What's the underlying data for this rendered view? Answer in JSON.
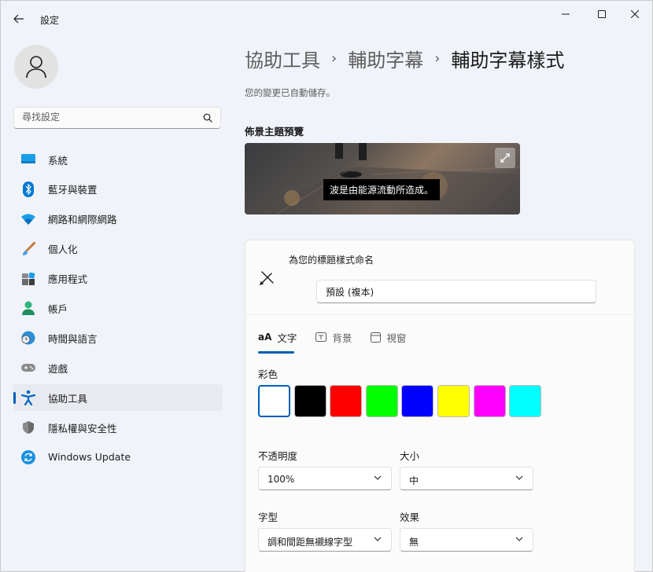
{
  "app": {
    "title": "設定"
  },
  "search": {
    "placeholder": "尋找設定"
  },
  "sidebar": {
    "items": [
      {
        "label": "系統",
        "icon": "monitor-icon"
      },
      {
        "label": "藍牙與裝置",
        "icon": "bluetooth-icon"
      },
      {
        "label": "網路和網際網路",
        "icon": "wifi-icon"
      },
      {
        "label": "個人化",
        "icon": "brush-icon"
      },
      {
        "label": "應用程式",
        "icon": "apps-icon"
      },
      {
        "label": "帳戶",
        "icon": "person-icon"
      },
      {
        "label": "時間與語言",
        "icon": "globe-clock-icon"
      },
      {
        "label": "遊戲",
        "icon": "gamepad-icon"
      },
      {
        "label": "協助工具",
        "icon": "accessibility-icon",
        "active": true
      },
      {
        "label": "隱私權與安全性",
        "icon": "shield-icon"
      },
      {
        "label": "Windows Update",
        "icon": "update-icon"
      }
    ]
  },
  "breadcrumb": {
    "level1": "協助工具",
    "level2": "輔助字幕",
    "level3": "輔助字幕樣式",
    "separator": "›"
  },
  "autosave_text": "您的變更已自動儲存。",
  "preview": {
    "title": "佈景主題預覽",
    "caption": "波是由能源流動所造成。"
  },
  "style_name": {
    "label": "為您的標題樣式命名",
    "value": "預設 (複本)"
  },
  "tabs": [
    {
      "label": "文字",
      "icon_text": "aA",
      "active": true
    },
    {
      "label": "背景",
      "icon_text": "T"
    },
    {
      "label": "視窗",
      "icon_text": ""
    }
  ],
  "color": {
    "label": "彩色",
    "swatches": [
      "#ffffff",
      "#000000",
      "#ff0000",
      "#00ff00",
      "#0000ff",
      "#ffff00",
      "#ff00ff",
      "#00ffff"
    ],
    "selected_index": 0
  },
  "opacity": {
    "label": "不透明度",
    "value": "100%"
  },
  "size": {
    "label": "大小",
    "value": "中"
  },
  "font": {
    "label": "字型",
    "value": "調和間距無襯線字型"
  },
  "effects": {
    "label": "效果",
    "value": "無"
  },
  "colors": {
    "accent": "#005fb8"
  }
}
